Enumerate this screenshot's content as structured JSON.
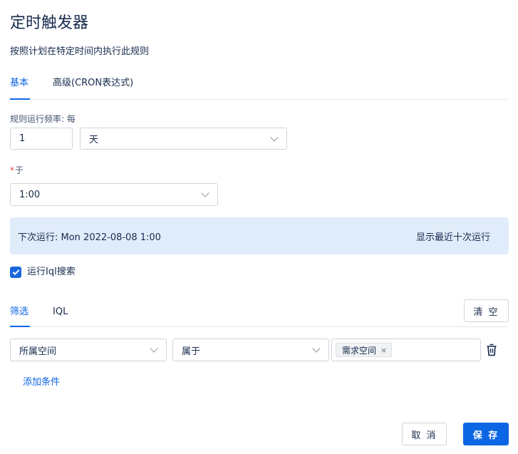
{
  "dialog": {
    "title": "定时触发器",
    "subtitle": "按照计划在特定时间内执行此规则"
  },
  "tabs": [
    {
      "label": "基本",
      "active": true
    },
    {
      "label": "高级(CRON表达式)",
      "active": false
    }
  ],
  "schedule": {
    "frequency_label": "规则运行频率: 每",
    "frequency_value": "1",
    "unit_value": "天",
    "at_required_mark": "*",
    "at_label": "于",
    "time_value": "1:00"
  },
  "next_run": {
    "text": "下次运行: Mon 2022-08-08 1:00",
    "show_last_ten": "显示最近十次运行"
  },
  "jql": {
    "checkbox_label": "运行Iql搜索",
    "checked": true
  },
  "filter_tabs": [
    {
      "label": "筛选",
      "active": true
    },
    {
      "label": "IQL",
      "active": false
    }
  ],
  "clear_button": "清 空",
  "condition": {
    "field": "所属空间",
    "operator": "属于",
    "tag": "需求空间",
    "tag_remove": "×"
  },
  "add_condition": "添加条件",
  "footer": {
    "cancel": "取 消",
    "save": "保 存"
  },
  "colors": {
    "accent": "#0c66e4",
    "banner": "#e1ecfb",
    "required": "#e2483d"
  }
}
